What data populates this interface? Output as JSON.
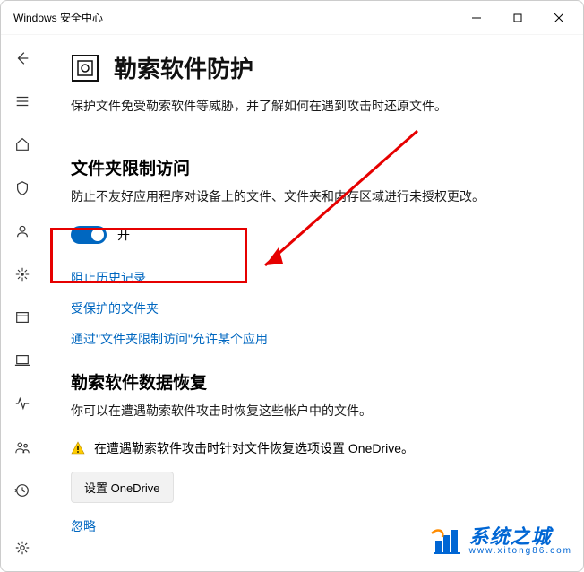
{
  "window": {
    "title": "Windows 安全中心"
  },
  "page": {
    "title": "勒索软件防护",
    "subtitle": "保护文件免受勒索软件等威胁，并了解如何在遇到攻击时还原文件。"
  },
  "folder_access": {
    "title": "文件夹限制访问",
    "desc": "防止不友好应用程序对设备上的文件、文件夹和内存区域进行未授权更改。",
    "toggle_state": "开",
    "links": {
      "history": "阻止历史记录",
      "protected": "受保护的文件夹",
      "allow": "通过\"文件夹限制访问\"允许某个应用"
    }
  },
  "recovery": {
    "title": "勒索软件数据恢复",
    "desc": "你可以在遭遇勒索软件攻击时恢复这些帐户中的文件。",
    "warning": "在遭遇勒索软件攻击时针对文件恢复选项设置 OneDrive。",
    "setup_btn": "设置 OneDrive",
    "dismiss": "忽略"
  },
  "watermark": {
    "main": "系统之城",
    "sub": "www.xitong86.com"
  }
}
